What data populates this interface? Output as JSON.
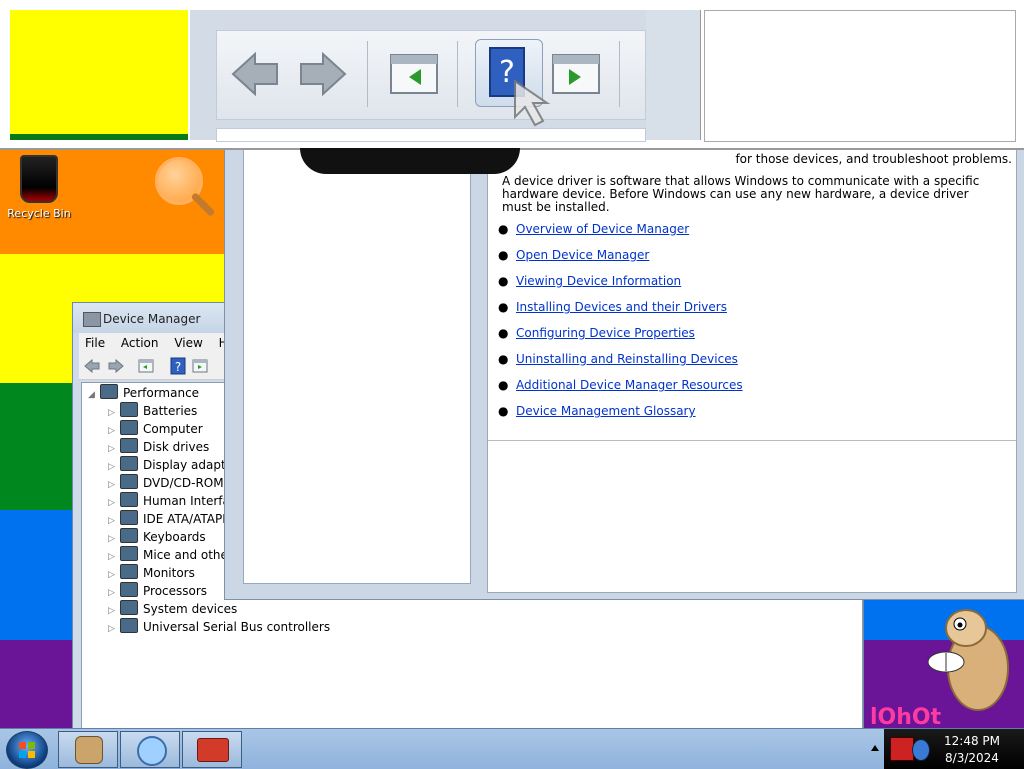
{
  "desktop": {
    "recycle_bin_label": "Recycle Bin"
  },
  "device_manager": {
    "title": "Device Manager",
    "menu": [
      "File",
      "Action",
      "View",
      "H"
    ],
    "tree": {
      "root": "Performance",
      "items": [
        "Batteries",
        "Computer",
        "Disk drives",
        "Display adapter",
        "DVD/CD-ROM",
        "Human Interfac",
        "IDE ATA/ATAPI",
        "Keyboards",
        "Mice and other",
        "Monitors",
        "Processors",
        "System devices",
        "Universal Serial Bus controllers"
      ]
    }
  },
  "help": {
    "partial_line": "for those devices, and troubleshoot problems.",
    "paragraph": "A device driver is software that allows Windows to communicate with a specific hardware device. Before Windows can use any new hardware, a device driver must be installed.",
    "links": [
      "Overview of Device Manager",
      "Open Device Manager",
      "Viewing Device Information",
      "Installing Devices and their Drivers",
      "Configuring Device Properties",
      "Uninstalling and Reinstalling Devices",
      "Additional Device Manager Resources",
      "Device Management Glossary"
    ]
  },
  "taskbar": {
    "time": "12:48 PM",
    "date": "8/3/2024"
  },
  "wallpaper": {
    "text": "lOhOt"
  }
}
